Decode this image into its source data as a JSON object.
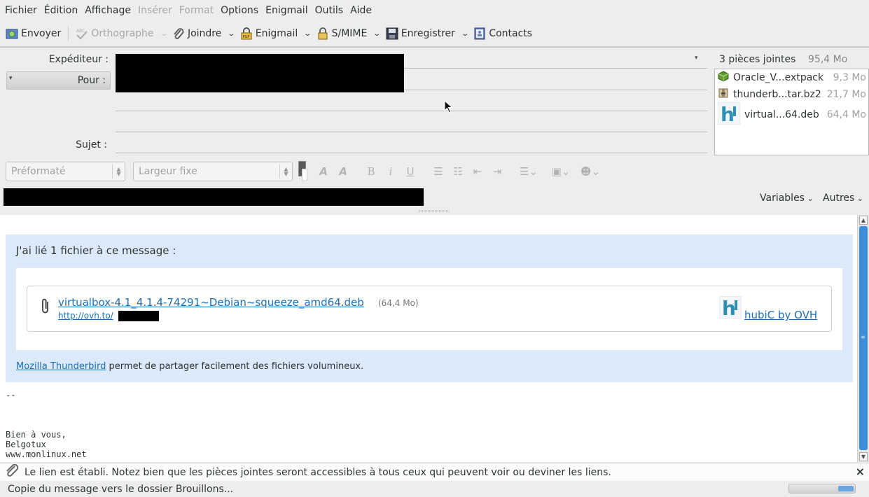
{
  "menubar": {
    "items": [
      {
        "label": "Fichier",
        "enabled": true
      },
      {
        "label": "Édition",
        "enabled": true
      },
      {
        "label": "Affichage",
        "enabled": true
      },
      {
        "label": "Insérer",
        "enabled": false
      },
      {
        "label": "Format",
        "enabled": false
      },
      {
        "label": "Options",
        "enabled": true
      },
      {
        "label": "Enigmail",
        "enabled": true
      },
      {
        "label": "Outils",
        "enabled": true
      },
      {
        "label": "Aide",
        "enabled": true
      }
    ]
  },
  "toolbar": {
    "send": "Envoyer",
    "spelling": "Orthographe",
    "attach": "Joindre",
    "enigmail": "Enigmail",
    "smime": "S/MIME",
    "save": "Enregistrer",
    "contacts": "Contacts"
  },
  "headers": {
    "from_label": "Expéditeur :",
    "to_label": "Pour :",
    "subject_label": "Sujet :"
  },
  "attachments": {
    "summary": "3 pièces jointes",
    "total_size": "95,4 Mo",
    "items": [
      {
        "name": "Oracle_V...extpack",
        "size": "9,3 Mo",
        "icon": "package-icon"
      },
      {
        "name": "thunderb...tar.bz2",
        "size": "21,7 Mo",
        "icon": "archive-icon"
      },
      {
        "name": "virtual...64.deb",
        "size": "64,4 Mo",
        "icon": "hubic-icon"
      }
    ]
  },
  "format_bar": {
    "paragraph_format": "Préformaté",
    "font": "Largeur fixe",
    "variables": "Variables",
    "others": "Autres"
  },
  "message": {
    "intro": "J'ai lié 1 fichier à ce message :",
    "file_link": "virtualbox-4.1_4.1.4-74291~Debian~squeeze_amd64.deb",
    "file_size": "(64,4 Mo)",
    "short_url": "http://ovh.to/",
    "provider": "hubiC by OVH",
    "footer_link": "Mozilla Thunderbird",
    "footer_text": " permet de partager facilement des fichiers volumineux.",
    "sig_sep": "--",
    "sig_line1": "Bien à vous,",
    "sig_line2": "Belgotux",
    "sig_line3": "www.monlinux.net"
  },
  "notification": {
    "text": "Le lien est établi. Notez bien que les pièces jointes seront accessibles à tous ceux qui peuvent voir ou deviner les liens.",
    "close": "×"
  },
  "status": {
    "text": "Copie du message vers le dossier Brouillons..."
  },
  "colors": {
    "link": "#1b6fb5",
    "selection_blue": "#3d8ed8",
    "cloud_box": "#dbe9f8"
  }
}
